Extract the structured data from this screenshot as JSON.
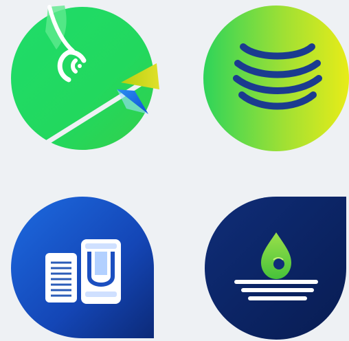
{
  "icons": [
    {
      "name": "pie-chart-signal-icon",
      "accent": "#2ee06c",
      "secondary": "#d4d61a",
      "tertiary": "#1f6fe0"
    },
    {
      "name": "waves-icon",
      "accent": "#3fdc55",
      "secondary": "#d6e81a",
      "stroke": "#1c3a8c"
    },
    {
      "name": "documents-icon",
      "accent": "#1e5fd0",
      "secondary": "#0e2a78"
    },
    {
      "name": "water-drop-icon",
      "accent": "#0e2a6e",
      "secondary": "#7cd93a"
    }
  ]
}
